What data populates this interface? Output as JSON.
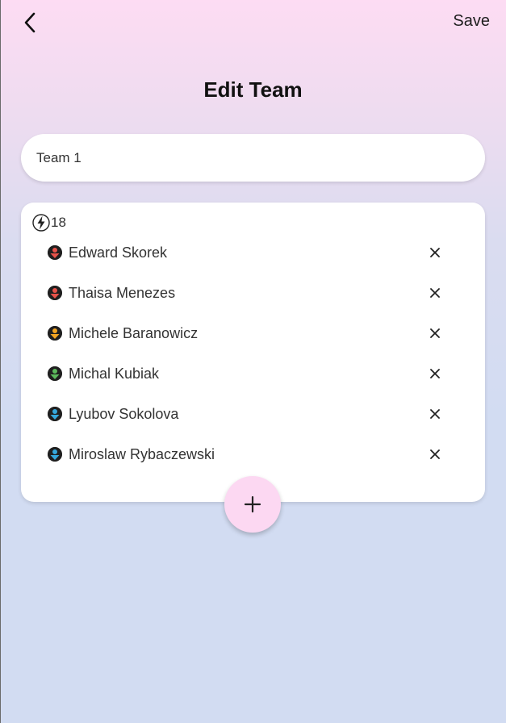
{
  "header": {
    "back_icon": "chevron-left-icon",
    "save_label": "Save",
    "title": "Edit Team"
  },
  "team_name_field": {
    "value": "Team 1"
  },
  "team_card": {
    "power_icon": "lightning-bolt-icon",
    "power_value": "18",
    "members": [
      {
        "name": "Edward Skorek",
        "avatar_color": "#e8534a",
        "icon": "person-icon"
      },
      {
        "name": "Thaisa Menezes",
        "avatar_color": "#e8534a",
        "icon": "person-icon"
      },
      {
        "name": "Michele Baranowicz",
        "avatar_color": "#f5a623",
        "icon": "person-icon"
      },
      {
        "name": "Michal Kubiak",
        "avatar_color": "#5cb85c",
        "icon": "person-icon"
      },
      {
        "name": "Lyubov Sokolova",
        "avatar_color": "#35a8dc",
        "icon": "person-icon"
      },
      {
        "name": "Miroslaw Rybaczewski",
        "avatar_color": "#35a8dc",
        "icon": "person-icon"
      }
    ],
    "remove_icon": "close-icon"
  },
  "fab": {
    "icon": "plus-icon"
  },
  "colors": {
    "gradient_top": "#fddcf3",
    "gradient_bottom": "#d2dcf2",
    "fab_background": "#fcd8f2"
  }
}
